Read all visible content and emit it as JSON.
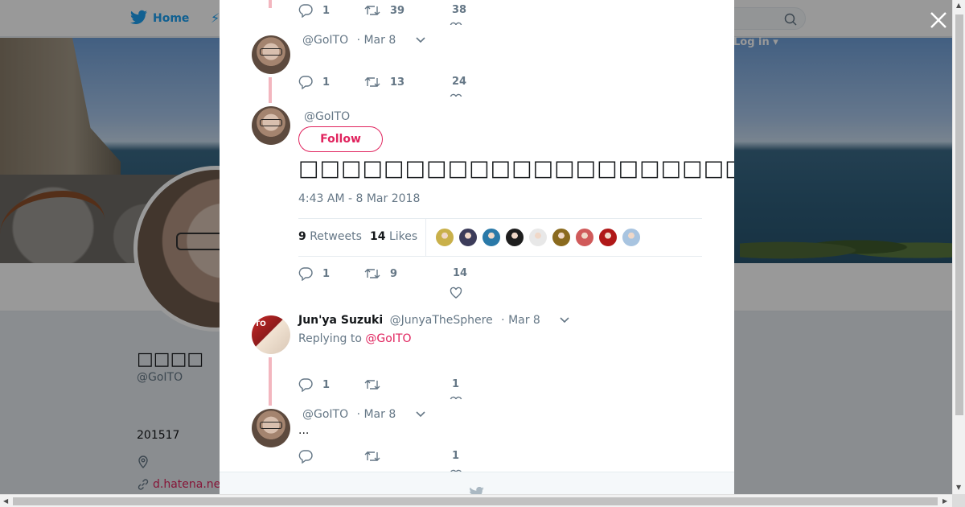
{
  "background_page": {
    "nav": {
      "home_label": "Home",
      "login_label": "Log in ▾"
    },
    "profile": {
      "display_name": "□□□□",
      "handle": "@GoITO",
      "bio": "201517",
      "link_text": "d.hatena.ne"
    }
  },
  "modal": {
    "tweets": [
      {
        "id": "prev",
        "reply_count": "1",
        "retweet_count": "39",
        "like_count": "38"
      },
      {
        "id": "reply-1",
        "handle": "@GoITO",
        "date": "· Mar 8",
        "reply_count": "1",
        "retweet_count": "13",
        "like_count": "24"
      },
      {
        "id": "main",
        "handle": "@GoITO",
        "follow_label": "Follow",
        "text": "□□□□□□□□□□□□□□□□□□□□□□□",
        "timestamp": "4:43 AM - 8 Mar 2018",
        "retweets_num": "9",
        "retweets_label": "Retweets",
        "likes_num": "14",
        "likes_label": "Likes",
        "reply_count": "1",
        "retweet_count": "9",
        "like_count": "14"
      },
      {
        "id": "reply-2",
        "display_name": "Jun'ya Suzuki",
        "handle": "@JunyaTheSphere",
        "date": "· Mar 8",
        "replying_prefix": "Replying to",
        "replying_to": "@GoITO",
        "reply_count": "1",
        "retweet_count": "",
        "like_count": "1"
      },
      {
        "id": "reply-3",
        "handle": "@GoITO",
        "date": "· Mar 8",
        "text": "...",
        "reply_count": "",
        "retweet_count": "",
        "like_count": "1"
      }
    ],
    "liker_colors": [
      "#c9b04a",
      "#3c3c5a",
      "#2a79a8",
      "#1e1e1e",
      "#e8e8e8",
      "#8a6a1e",
      "#d05a5a",
      "#b01818",
      "#a8c4e0"
    ]
  },
  "colors": {
    "accent": "#e0245e",
    "twitter_blue": "#1da1f2",
    "muted": "#657786",
    "thread_line": "#f3b6bf"
  },
  "icons": [
    "twitter-bird-icon",
    "search-icon",
    "close-icon",
    "reply-icon",
    "retweet-icon",
    "heart-icon",
    "chevron-down-icon",
    "location-icon",
    "link-icon"
  ]
}
